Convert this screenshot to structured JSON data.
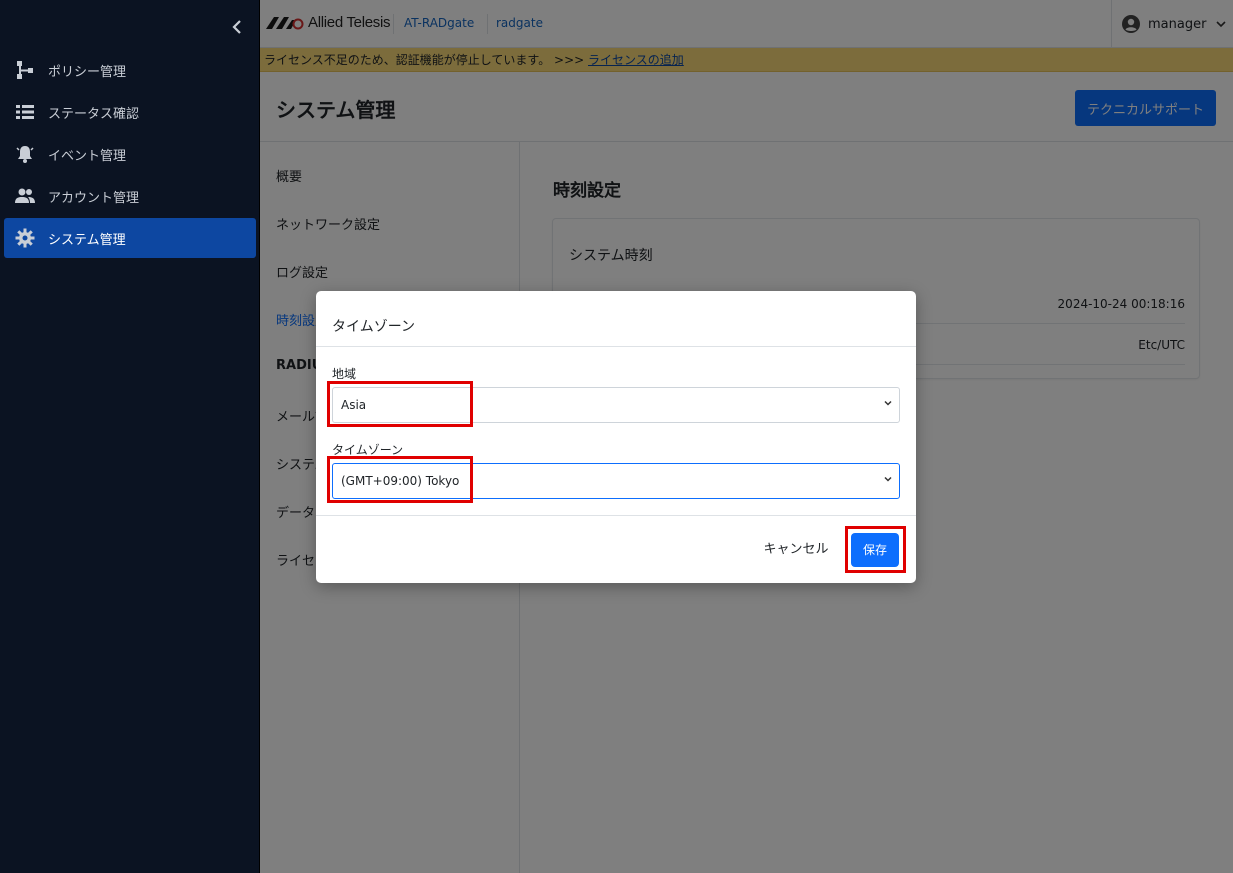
{
  "sidebar": {
    "collapse_glyph": "‹",
    "items": [
      {
        "label": "ポリシー管理",
        "icon": "sitemap-icon",
        "active": false
      },
      {
        "label": "ステータス確認",
        "icon": "list-icon",
        "active": false
      },
      {
        "label": "イベント管理",
        "icon": "bell-icon",
        "active": false
      },
      {
        "label": "アカウント管理",
        "icon": "users-icon",
        "active": false
      },
      {
        "label": "システム管理",
        "icon": "gear-icon",
        "active": true
      }
    ]
  },
  "topbar": {
    "logo_text": "Allied Telesis",
    "product": "AT-RADgate",
    "host": "radgate",
    "user": "manager"
  },
  "license_warning": {
    "message": "ライセンス不足のため、認証機能が停止しています。 >>> ",
    "link": "ライセンスの追加"
  },
  "page": {
    "title": "システム管理",
    "support_button": "テクニカルサポート"
  },
  "subnav": {
    "items": [
      {
        "label": "概要"
      },
      {
        "label": "ネットワーク設定"
      },
      {
        "label": "ログ設定"
      },
      {
        "label": "時刻設定",
        "active": true
      },
      {
        "label": "RADIUS"
      },
      {
        "label": "メール設定"
      },
      {
        "label": "システム"
      },
      {
        "label": "データ"
      },
      {
        "label": "ライセ"
      }
    ]
  },
  "content": {
    "section_title": "時刻設定",
    "card_title": "システム時刻",
    "system_time": "2024-10-24 00:18:16",
    "timezone_value": "Etc/UTC"
  },
  "modal": {
    "title": "タイムゾーン",
    "region_label": "地域",
    "region_value": "Asia",
    "timezone_label": "タイムゾーン",
    "timezone_value": "(GMT+09:00) Tokyo",
    "cancel": "キャンセル",
    "save": "保存"
  },
  "colors": {
    "sidebar_bg": "#0b1322",
    "active_nav": "#0d47a1",
    "primary": "#0d6efd",
    "warning_bg": "#f8d879",
    "highlight": "#e00000"
  }
}
